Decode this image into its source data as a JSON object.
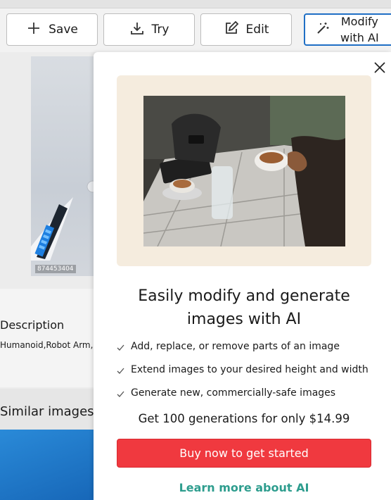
{
  "toolbar": {
    "save_label": "Save",
    "try_label": "Try",
    "edit_label": "Edit",
    "modify_ai_line1": "Modify",
    "modify_ai_line2": "with AI"
  },
  "left": {
    "image_id": "874453404",
    "description_title": "Description",
    "description_tags": "Humanoid,Robot Arm, C",
    "similar_title": "Similar images"
  },
  "popover": {
    "headline_line1": "Easily modify and generate",
    "headline_line2": "images with AI",
    "features": [
      "Add, replace, or remove parts of an image",
      "Extend images to your desired height and width",
      "Generate new, commercially-safe images"
    ],
    "offer": "Get 100 generations for only $14.99",
    "buy_label": "Buy now to get started",
    "learn_label": "Learn more about AI"
  },
  "colors": {
    "accent_blue": "#1f6fc5",
    "buy_red": "#f0393f",
    "learn_teal": "#2e9d8e",
    "hero_bg": "#f5ecde"
  },
  "icons": [
    "plus-icon",
    "download-icon",
    "edit-icon",
    "magic-wand-icon",
    "close-icon",
    "check-icon"
  ]
}
